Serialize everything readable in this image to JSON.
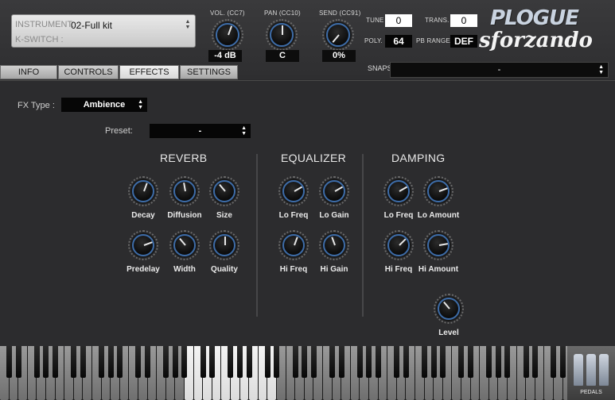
{
  "header": {
    "instrument_label": "INSTRUMENT:",
    "instrument_value": "02-Full kit",
    "kswitch_label": "K-SWITCH :",
    "vol_label": "VOL. (CC7)",
    "vol_value": "-4 dB",
    "pan_label": "PAN (CC10)",
    "pan_value": "C",
    "send_label": "SEND (CC91)",
    "send_value": "0%",
    "tune_label": "TUNE",
    "tune_value": "0",
    "trans_label": "TRANS.",
    "trans_value": "0",
    "poly_label": "POLY.",
    "poly_value": "64",
    "pbrange_label": "PB RANGE",
    "pbrange_value": "DEF",
    "logo_brand": "PLOGUE",
    "logo_product": "sforzando"
  },
  "tabs": [
    "INFO",
    "CONTROLS",
    "EFFECTS",
    "SETTINGS"
  ],
  "active_tab": "EFFECTS",
  "snapshot": {
    "label": "SNAPSHOT",
    "value": "-"
  },
  "effects": {
    "fx_type_label": "FX Type :",
    "fx_type_value": "Ambience",
    "preset_label": "Preset:",
    "preset_value": "-",
    "reverb": {
      "title": "REVERB",
      "knobs": [
        "Decay",
        "Diffusion",
        "Size",
        "Predelay",
        "Width",
        "Quality"
      ]
    },
    "equalizer": {
      "title": "EQUALIZER",
      "knobs": [
        "Lo Freq",
        "Lo Gain",
        "Hi Freq",
        "Hi Gain"
      ]
    },
    "damping": {
      "title": "DAMPING",
      "knobs": [
        "Lo Freq",
        "Lo Amount",
        "Hi Freq",
        "Hi Amount"
      ]
    },
    "level_label": "Level"
  },
  "pedals_label": "PEDALS",
  "colors": {
    "knob_ring": "#3d6ca8",
    "panel": "#2c2c2e"
  }
}
